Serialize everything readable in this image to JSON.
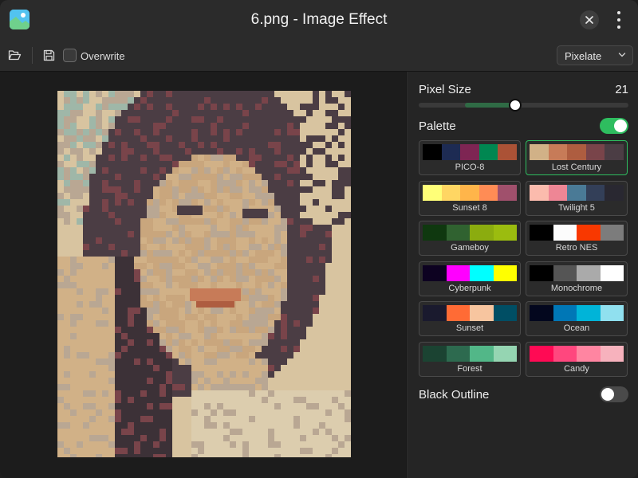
{
  "window": {
    "title": "6.png - Image Effect"
  },
  "toolbar": {
    "overwrite_label": "Overwrite",
    "overwrite_checked": false,
    "effect_select": "Pixelate"
  },
  "panel": {
    "pixel_size_label": "Pixel Size",
    "pixel_size_value": "21",
    "palette_label": "Palette",
    "palette_enabled": true,
    "black_outline_label": "Black Outline",
    "black_outline_enabled": false,
    "selected_palette": "Lost Century",
    "palettes": [
      {
        "name": "PICO-8",
        "colors": [
          "#000000",
          "#1d2b53",
          "#7e2553",
          "#008751",
          "#ab5236"
        ]
      },
      {
        "name": "Lost Century",
        "colors": [
          "#d1b187",
          "#c77b58",
          "#ae5d40",
          "#79444a",
          "#4b3d44"
        ]
      },
      {
        "name": "Sunset 8",
        "colors": [
          "#ffff78",
          "#ffd663",
          "#ffb54a",
          "#ff8c55",
          "#a0506c"
        ]
      },
      {
        "name": "Twilight 5",
        "colors": [
          "#fbbbad",
          "#ee8695",
          "#4a7a96",
          "#333f58",
          "#292831"
        ]
      },
      {
        "name": "Gameboy",
        "colors": [
          "#0f380f",
          "#306230",
          "#8bac0f",
          "#9bbc0f"
        ]
      },
      {
        "name": "Retro NES",
        "colors": [
          "#000000",
          "#fcfcfc",
          "#f83800",
          "#7c7c7c"
        ]
      },
      {
        "name": "Cyberpunk",
        "colors": [
          "#0d0221",
          "#ff00ff",
          "#00ffff",
          "#ffff00"
        ]
      },
      {
        "name": "Monochrome",
        "colors": [
          "#000000",
          "#555555",
          "#aaaaaa",
          "#ffffff"
        ]
      },
      {
        "name": "Sunset",
        "colors": [
          "#1a1a2e",
          "#ff6b35",
          "#f7c59f",
          "#004e64"
        ]
      },
      {
        "name": "Ocean",
        "colors": [
          "#03071e",
          "#0077b6",
          "#00b4d8",
          "#90e0ef"
        ]
      },
      {
        "name": "Forest",
        "colors": [
          "#1b4332",
          "#2d6a4f",
          "#52b788",
          "#95d5b2"
        ]
      },
      {
        "name": "Candy",
        "colors": [
          "#ff0a54",
          "#ff477e",
          "#ff85a1",
          "#f7b2bd"
        ]
      }
    ]
  },
  "colors": {
    "accent": "#2ebd5f",
    "slider_fill": "#2f6b45",
    "background": "#1f1f1f",
    "panel": "#252525"
  }
}
